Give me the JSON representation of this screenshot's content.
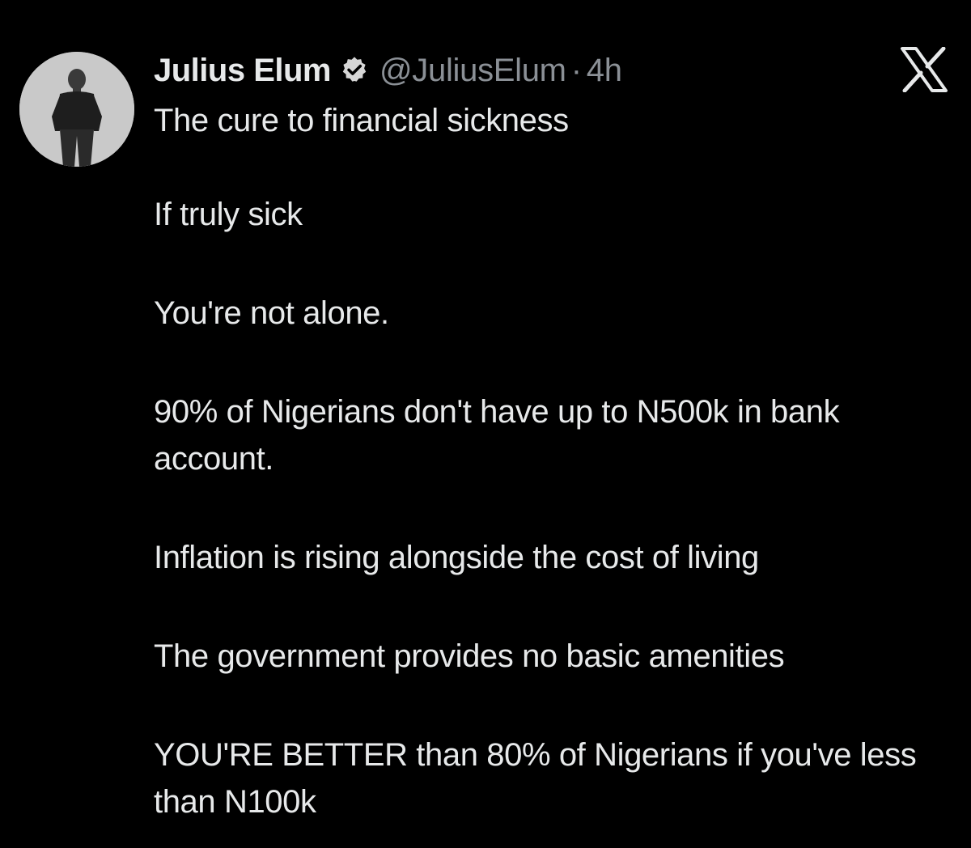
{
  "author": {
    "display_name": "Julius Elum",
    "handle": "@JuliusElum",
    "separator": "·",
    "time": "4h",
    "verified": true
  },
  "icons": {
    "avatar": "profile-photo",
    "verified": "verified-badge-icon",
    "logo": "x-logo-icon"
  },
  "colors": {
    "background": "#000000",
    "text_primary": "#e7e9ea",
    "text_secondary": "#8b9096"
  },
  "tweet": {
    "paragraphs": [
      "The cure to financial sickness",
      "If truly sick",
      "You're not alone.",
      "90% of Nigerians don't have up to N500k in bank account.",
      "Inflation is rising alongside the cost of living",
      "The government provides no basic amenities",
      "YOU'RE BETTER than 80% of Nigerians if you've less than N100k"
    ]
  }
}
